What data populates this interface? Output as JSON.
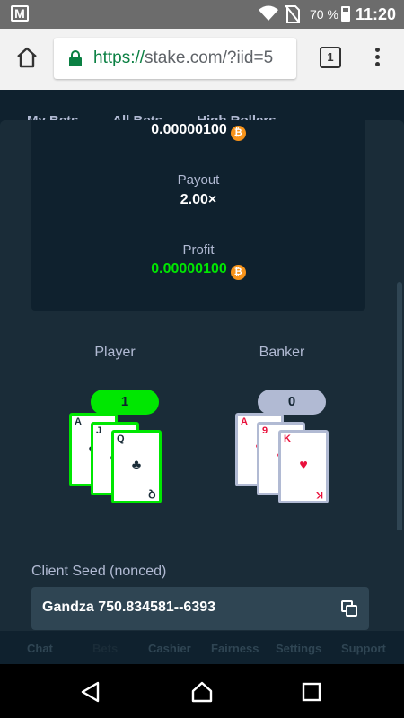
{
  "statusbar": {
    "battery": "70 %",
    "time": "11:20",
    "gmail_icon": "gmail-icon",
    "wifi_icon": "wifi-icon",
    "sim_icon": "no-sim-icon"
  },
  "browser": {
    "url_scheme": "https://",
    "url_rest": "stake.com/?iid=5",
    "tab_count": "1"
  },
  "background_tabs": [
    "My Bets",
    "All Bets",
    "High Rollers"
  ],
  "bet": {
    "amount": "0.00000100",
    "payout_label": "Payout",
    "payout_value": "2.00×",
    "profit_label": "Profit",
    "profit_value": "0.00000100",
    "currency_icon": "bitcoin-icon",
    "btc_symbol": "₿"
  },
  "game": {
    "player_label": "Player",
    "banker_label": "Banker",
    "player_score": "1",
    "banker_score": "0",
    "player_cards": [
      {
        "rank": "A",
        "suit": "♣",
        "color": "black"
      },
      {
        "rank": "J",
        "suit": "♣",
        "color": "black"
      },
      {
        "rank": "Q",
        "suit": "♣",
        "color": "black"
      }
    ],
    "banker_cards": [
      {
        "rank": "A",
        "suit": "♥",
        "color": "red"
      },
      {
        "rank": "9",
        "suit": "♥",
        "color": "red"
      },
      {
        "rank": "K",
        "suit": "♥",
        "color": "red"
      }
    ]
  },
  "seed": {
    "label": "Client Seed (nonced)",
    "value": "Gandza 750.834581--6393"
  },
  "bottom_nav": [
    "Chat",
    "Bets",
    "Cashier",
    "Fairness",
    "Settings",
    "Support"
  ],
  "colors": {
    "win": "#00e701",
    "bg": "#0f212e",
    "panel": "#1a2c38",
    "btc": "#f7931a"
  }
}
